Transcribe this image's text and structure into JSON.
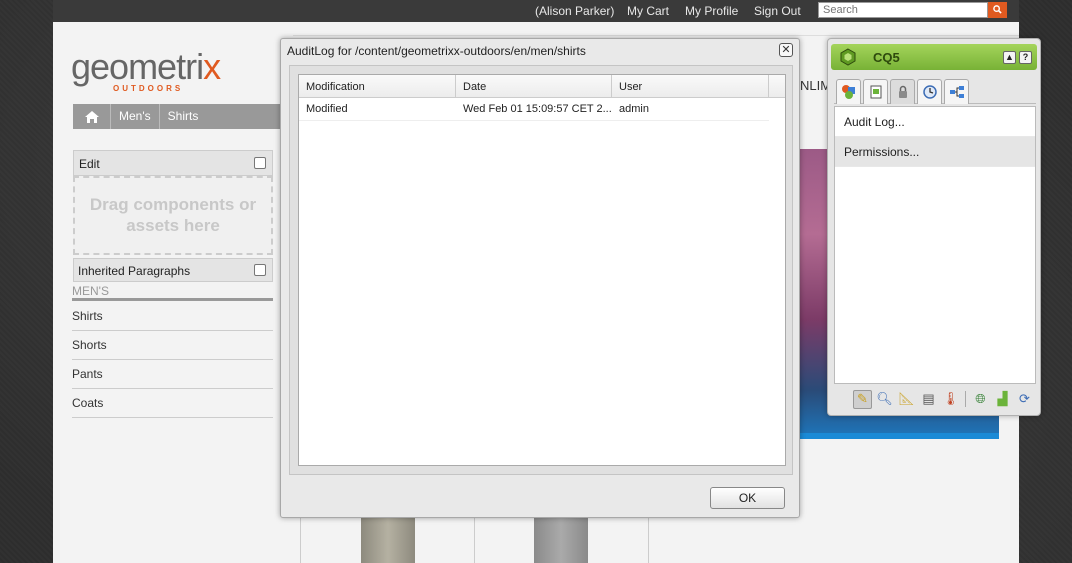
{
  "topbar": {
    "user": "(Alison Parker)",
    "cart": "My Cart",
    "profile": "My Profile",
    "signout": "Sign Out",
    "search_placeholder": "Search"
  },
  "brand": {
    "logo_main_pre": "geometri",
    "logo_main_x": "x",
    "logo_sub": "OUTDOORS",
    "accent": "#e05a20"
  },
  "breadcrumb": {
    "items": [
      "Men's",
      "Shirts"
    ]
  },
  "parsys": {
    "edit_label": "Edit",
    "dropzone_text": "Drag components or assets here",
    "inherited_label": "Inherited Paragraphs"
  },
  "menu": {
    "title": "MEN'S",
    "items": [
      "Shirts",
      "Shorts",
      "Pants",
      "Coats"
    ]
  },
  "hero": {
    "partial_text": "NLIM"
  },
  "dialog": {
    "title": "AuditLog for /content/geometrixx-outdoors/en/men/shirts",
    "columns": [
      "Modification",
      "Date",
      "User"
    ],
    "rows": [
      {
        "modification": "Modified",
        "date": "Wed Feb 01 15:09:57 CET 2...",
        "user": "admin"
      }
    ],
    "ok_label": "OK"
  },
  "sidekick": {
    "title": "CQ5",
    "items": [
      "Audit Log...",
      "Permissions..."
    ],
    "header_color": "#8cc540"
  }
}
